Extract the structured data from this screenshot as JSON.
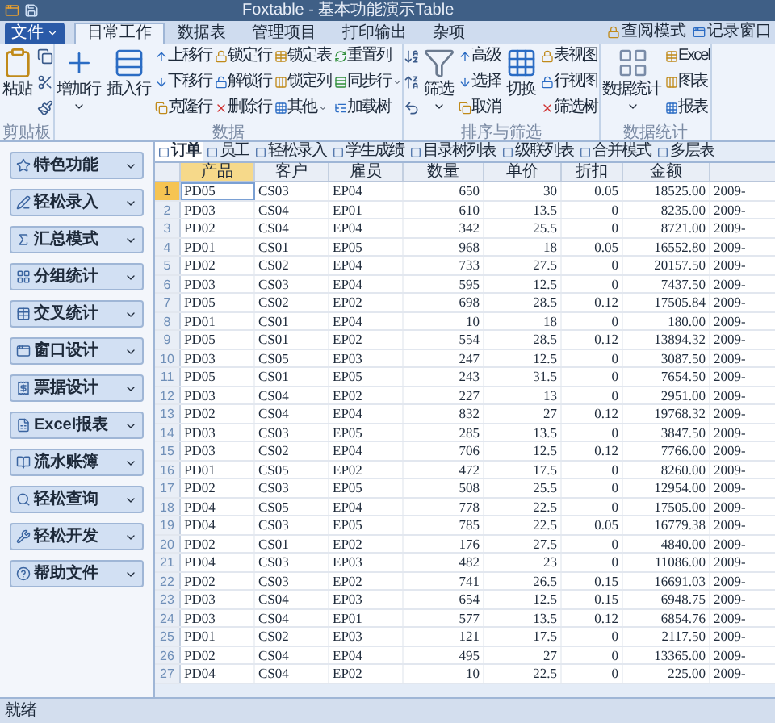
{
  "window": {
    "title": "Foxtable - 基本功能演示Table"
  },
  "file_menu": {
    "label": "文件"
  },
  "ribbon_tabs": [
    {
      "label": "日常工作",
      "selected": true
    },
    {
      "label": "数据表",
      "selected": false
    },
    {
      "label": "管理项目",
      "selected": false
    },
    {
      "label": "打印输出",
      "selected": false
    },
    {
      "label": "杂项",
      "selected": false
    }
  ],
  "ribbon_right": [
    {
      "label": "查阅模式"
    },
    {
      "label": "记录窗口"
    }
  ],
  "ribbon_groups": [
    {
      "label": "剪贴板",
      "columns": [
        {
          "kind": "large",
          "label": "粘贴"
        },
        {
          "kind": "clipboard_tools"
        }
      ]
    },
    {
      "label": "数据",
      "columns": [
        {
          "kind": "large",
          "label": "增加行",
          "dropdown": true
        },
        {
          "kind": "large",
          "label": "插入行"
        },
        {
          "kind": "stack",
          "items": [
            {
              "label": "上移行"
            },
            {
              "label": "下移行"
            },
            {
              "label": "克隆行"
            }
          ]
        },
        {
          "kind": "stack",
          "items": [
            {
              "label": "锁定行"
            },
            {
              "label": "解锁行"
            },
            {
              "label": "删除行"
            }
          ]
        },
        {
          "kind": "stack",
          "items": [
            {
              "label": "锁定表"
            },
            {
              "label": "锁定列"
            },
            {
              "label": "其他",
              "dropdown": true
            }
          ]
        },
        {
          "kind": "stack",
          "items": [
            {
              "label": "重置列"
            },
            {
              "label": "同步行",
              "dropdown": true
            },
            {
              "label": "加载树"
            }
          ]
        }
      ]
    },
    {
      "label": "排序与筛选",
      "columns": [
        {
          "kind": "sort_tools"
        },
        {
          "kind": "large",
          "label": "筛选",
          "dropdown": true
        },
        {
          "kind": "stack",
          "items": [
            {
              "label": "高级"
            },
            {
              "label": "选择"
            },
            {
              "label": "取消"
            }
          ]
        },
        {
          "kind": "large",
          "label": "切换"
        },
        {
          "kind": "stack",
          "items": [
            {
              "label": "表视图"
            },
            {
              "label": "行视图"
            },
            {
              "label": "筛选树"
            }
          ]
        }
      ]
    },
    {
      "label": "数据统计",
      "columns": [
        {
          "kind": "large",
          "label": "数据统计",
          "dropdown": true
        },
        {
          "kind": "stack",
          "items": [
            {
              "label": "Excel"
            },
            {
              "label": "图表"
            },
            {
              "label": "报表"
            }
          ]
        }
      ]
    }
  ],
  "sidebar": {
    "items": [
      {
        "label": "特色功能"
      },
      {
        "label": "轻松录入"
      },
      {
        "label": "汇总模式"
      },
      {
        "label": "分组统计"
      },
      {
        "label": "交叉统计"
      },
      {
        "label": "窗口设计"
      },
      {
        "label": "票据设计"
      },
      {
        "label": "Excel报表"
      },
      {
        "label": "流水账簿"
      },
      {
        "label": "轻松查询"
      },
      {
        "label": "轻松开发"
      },
      {
        "label": "帮助文件"
      }
    ]
  },
  "table": {
    "tabs": [
      {
        "label": "订单",
        "selected": true
      },
      {
        "label": "员工",
        "selected": false
      },
      {
        "label": "轻松录入",
        "selected": false
      },
      {
        "label": "学生成绩",
        "selected": false
      },
      {
        "label": "目录树列表",
        "selected": false
      },
      {
        "label": "级联列表",
        "selected": false
      },
      {
        "label": "合并模式",
        "selected": false
      },
      {
        "label": "多层表",
        "selected": false
      }
    ],
    "columns": [
      "产品",
      "客户",
      "雇员",
      "数量",
      "单价",
      "折扣",
      "金额"
    ],
    "rows": [
      {
        "number": "1",
        "selected": true,
        "cells": [
          "PD05",
          "CS03",
          "EP04",
          "650",
          "30",
          "0.05",
          "18525.00",
          "2009-"
        ]
      },
      {
        "number": "2",
        "selected": false,
        "cells": [
          "PD03",
          "CS04",
          "EP01",
          "610",
          "13.5",
          "0",
          "8235.00",
          "2009-"
        ]
      },
      {
        "number": "3",
        "selected": false,
        "cells": [
          "PD02",
          "CS04",
          "EP04",
          "342",
          "25.5",
          "0",
          "8721.00",
          "2009-"
        ]
      },
      {
        "number": "4",
        "selected": false,
        "cells": [
          "PD01",
          "CS01",
          "EP05",
          "968",
          "18",
          "0.05",
          "16552.80",
          "2009-"
        ]
      },
      {
        "number": "5",
        "selected": false,
        "cells": [
          "PD02",
          "CS02",
          "EP04",
          "733",
          "27.5",
          "0",
          "20157.50",
          "2009-"
        ]
      },
      {
        "number": "6",
        "selected": false,
        "cells": [
          "PD03",
          "CS03",
          "EP04",
          "595",
          "12.5",
          "0",
          "7437.50",
          "2009-"
        ]
      },
      {
        "number": "7",
        "selected": false,
        "cells": [
          "PD05",
          "CS02",
          "EP02",
          "698",
          "28.5",
          "0.12",
          "17505.84",
          "2009-"
        ]
      },
      {
        "number": "8",
        "selected": false,
        "cells": [
          "PD01",
          "CS01",
          "EP04",
          "10",
          "18",
          "0",
          "180.00",
          "2009-"
        ]
      },
      {
        "number": "9",
        "selected": false,
        "cells": [
          "PD05",
          "CS01",
          "EP02",
          "554",
          "28.5",
          "0.12",
          "13894.32",
          "2009-"
        ]
      },
      {
        "number": "10",
        "selected": false,
        "cells": [
          "PD03",
          "CS05",
          "EP03",
          "247",
          "12.5",
          "0",
          "3087.50",
          "2009-"
        ]
      },
      {
        "number": "11",
        "selected": false,
        "cells": [
          "PD05",
          "CS01",
          "EP05",
          "243",
          "31.5",
          "0",
          "7654.50",
          "2009-"
        ]
      },
      {
        "number": "12",
        "selected": false,
        "cells": [
          "PD03",
          "CS04",
          "EP02",
          "227",
          "13",
          "0",
          "2951.00",
          "2009-"
        ]
      },
      {
        "number": "13",
        "selected": false,
        "cells": [
          "PD02",
          "CS04",
          "EP04",
          "832",
          "27",
          "0.12",
          "19768.32",
          "2009-"
        ]
      },
      {
        "number": "14",
        "selected": false,
        "cells": [
          "PD03",
          "CS03",
          "EP05",
          "285",
          "13.5",
          "0",
          "3847.50",
          "2009-"
        ]
      },
      {
        "number": "15",
        "selected": false,
        "cells": [
          "PD03",
          "CS02",
          "EP04",
          "706",
          "12.5",
          "0.12",
          "7766.00",
          "2009-"
        ]
      },
      {
        "number": "16",
        "selected": false,
        "cells": [
          "PD01",
          "CS05",
          "EP02",
          "472",
          "17.5",
          "0",
          "8260.00",
          "2009-"
        ]
      },
      {
        "number": "17",
        "selected": false,
        "cells": [
          "PD02",
          "CS03",
          "EP05",
          "508",
          "25.5",
          "0",
          "12954.00",
          "2009-"
        ]
      },
      {
        "number": "18",
        "selected": false,
        "cells": [
          "PD04",
          "CS05",
          "EP04",
          "778",
          "22.5",
          "0",
          "17505.00",
          "2009-"
        ]
      },
      {
        "number": "19",
        "selected": false,
        "cells": [
          "PD04",
          "CS03",
          "EP05",
          "785",
          "22.5",
          "0.05",
          "16779.38",
          "2009-"
        ]
      },
      {
        "number": "20",
        "selected": false,
        "cells": [
          "PD02",
          "CS01",
          "EP02",
          "176",
          "27.5",
          "0",
          "4840.00",
          "2009-"
        ]
      },
      {
        "number": "21",
        "selected": false,
        "cells": [
          "PD04",
          "CS03",
          "EP03",
          "482",
          "23",
          "0",
          "11086.00",
          "2009-"
        ]
      },
      {
        "number": "22",
        "selected": false,
        "cells": [
          "PD02",
          "CS03",
          "EP02",
          "741",
          "26.5",
          "0.15",
          "16691.03",
          "2009-"
        ]
      },
      {
        "number": "23",
        "selected": false,
        "cells": [
          "PD03",
          "CS04",
          "EP03",
          "654",
          "12.5",
          "0.15",
          "6948.75",
          "2009-"
        ]
      },
      {
        "number": "24",
        "selected": false,
        "cells": [
          "PD03",
          "CS04",
          "EP01",
          "577",
          "13.5",
          "0.12",
          "6854.76",
          "2009-"
        ]
      },
      {
        "number": "25",
        "selected": false,
        "cells": [
          "PD01",
          "CS02",
          "EP03",
          "121",
          "17.5",
          "0",
          "2117.50",
          "2009-"
        ]
      },
      {
        "number": "26",
        "selected": false,
        "cells": [
          "PD02",
          "CS04",
          "EP04",
          "495",
          "27",
          "0",
          "13365.00",
          "2009-"
        ]
      },
      {
        "number": "27",
        "selected": false,
        "cells": [
          "PD04",
          "CS04",
          "EP02",
          "10",
          "22.5",
          "0",
          "225.00",
          "2009-"
        ]
      }
    ]
  },
  "status_bar": {
    "text": "就绪"
  }
}
